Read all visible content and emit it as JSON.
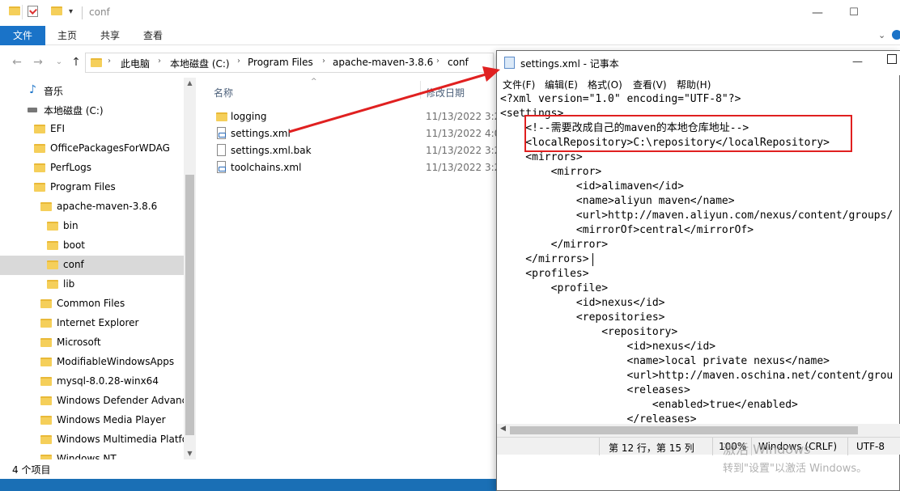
{
  "explorer": {
    "title": "conf",
    "ribbon_tabs": [
      "文件",
      "主页",
      "共享",
      "查看"
    ],
    "breadcrumb": [
      "此电脑",
      "本地磁盘 (C:)",
      "Program Files",
      "apache-maven-3.8.6",
      "conf"
    ],
    "nav_items": [
      {
        "label": "音乐"
      },
      {
        "label": "本地磁盘 (C:)"
      },
      {
        "label": "EFI"
      },
      {
        "label": "OfficePackagesForWDAG"
      },
      {
        "label": "PerfLogs"
      },
      {
        "label": "Program Files"
      },
      {
        "label": "apache-maven-3.8.6"
      },
      {
        "label": "bin"
      },
      {
        "label": "boot"
      },
      {
        "label": "conf"
      },
      {
        "label": "lib"
      },
      {
        "label": "Common Files"
      },
      {
        "label": "Internet Explorer"
      },
      {
        "label": "Microsoft"
      },
      {
        "label": "ModifiableWindowsApps"
      },
      {
        "label": "mysql-8.0.28-winx64"
      },
      {
        "label": "Windows Defender Advanc"
      },
      {
        "label": "Windows Media Player"
      },
      {
        "label": "Windows Multimedia Platfo"
      },
      {
        "label": "Windows NT"
      }
    ],
    "columns": {
      "name": "名称",
      "date": "修改日期"
    },
    "files": [
      {
        "name": "logging",
        "date": "11/13/2022 3:2",
        "icon": "folder-icon"
      },
      {
        "name": "settings.xml",
        "date": "11/13/2022 4:0",
        "icon": "xml-file-icon"
      },
      {
        "name": "settings.xml.bak",
        "date": "11/13/2022 3:2",
        "icon": "file-icon"
      },
      {
        "name": "toolchains.xml",
        "date": "11/13/2022 3:2",
        "icon": "xml-file-icon"
      }
    ],
    "status": "4 个项目"
  },
  "notepad": {
    "title": "settings.xml - 记事本",
    "menu": [
      "文件(F)",
      "编辑(E)",
      "格式(O)",
      "查看(V)",
      "帮助(H)"
    ],
    "lines": [
      "<?xml version=\"1.0\" encoding=\"UTF-8\"?>",
      "<settings>",
      "    <!--需要改成自己的maven的本地仓库地址-->",
      "    <localRepository>C:\\repository</localRepository>",
      "    <mirrors>",
      "        <mirror>",
      "            <id>alimaven</id>",
      "            <name>aliyun maven</name>",
      "            <url>http://maven.aliyun.com/nexus/content/groups/",
      "            <mirrorOf>central</mirrorOf>",
      "        </mirror>",
      "    </mirrors>",
      "    <profiles>",
      "        <profile>",
      "            <id>nexus</id>",
      "            <repositories>",
      "                <repository>",
      "                    <id>nexus</id>",
      "                    <name>local private nexus</name>",
      "                    <url>http://maven.oschina.net/content/grou",
      "                    <releases>",
      "                        <enabled>true</enabled>",
      "                    </releases>"
    ],
    "status": {
      "position": "第 12 行，第 15 列",
      "zoom": "100%",
      "eol": "Windows (CRLF)",
      "encoding": "UTF-8"
    }
  },
  "watermark": {
    "line1": "激活 Windows",
    "line2": "转到\"设置\"以激活 Windows。"
  },
  "colors": {
    "accent": "#1a73c8",
    "highlight_box": "#e02020",
    "arrow": "#e02020"
  }
}
